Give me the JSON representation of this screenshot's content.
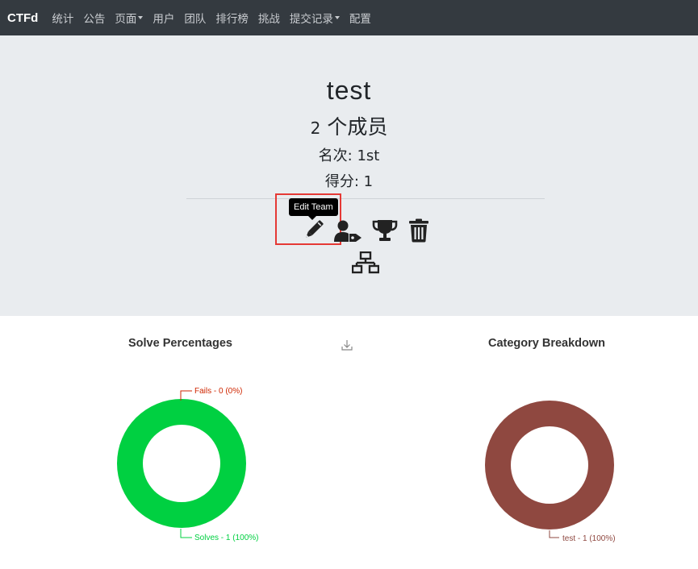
{
  "navbar": {
    "brand": "CTFd",
    "items": [
      {
        "label": "统计",
        "dropdown": false
      },
      {
        "label": "公告",
        "dropdown": false
      },
      {
        "label": "页面",
        "dropdown": true
      },
      {
        "label": "用户",
        "dropdown": false
      },
      {
        "label": "团队",
        "dropdown": false
      },
      {
        "label": "排行榜",
        "dropdown": false
      },
      {
        "label": "挑战",
        "dropdown": false
      },
      {
        "label": "提交记录",
        "dropdown": true
      },
      {
        "label": "配置",
        "dropdown": false
      }
    ]
  },
  "team": {
    "name": "test",
    "member_count": "2",
    "members_label": "个成员",
    "place": "名次: 1st",
    "score": "得分: 1"
  },
  "actions": {
    "tooltip": "Edit Team",
    "icons": [
      "pencil-icon",
      "user-tag-icon",
      "trophy-icon",
      "trash-icon",
      "network-icon"
    ]
  },
  "colors": {
    "navbar": "#343a40",
    "jumbotron": "#e9ecef",
    "solves": "#00d041",
    "fails": "#cf2600",
    "category": "#8f4840",
    "highlight": "#e53935"
  },
  "chart_data": [
    {
      "type": "pie",
      "title": "Solve Percentages",
      "labels": [
        "Fails",
        "Solves"
      ],
      "values": [
        0,
        1
      ],
      "percent": [
        0,
        100
      ],
      "annotations": [
        "Fails - 0 (0%)",
        "Solves - 1 (100%)"
      ]
    },
    {
      "type": "pie",
      "title": "Category Breakdown",
      "labels": [
        "test"
      ],
      "values": [
        1
      ],
      "percent": [
        100
      ],
      "annotations": [
        "test - 1 (100%)"
      ]
    }
  ]
}
